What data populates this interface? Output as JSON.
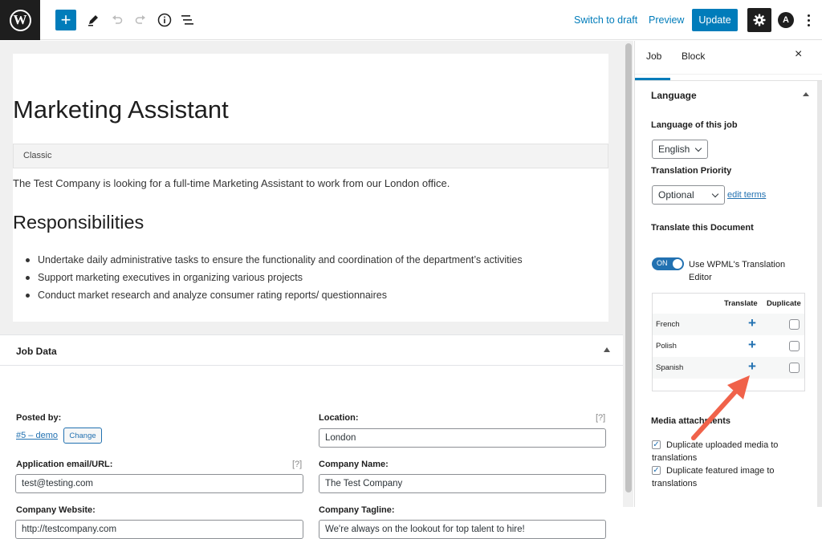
{
  "colors": {
    "accent": "#007cba",
    "dark": "#1e1e1e",
    "annotation_arrow": "#f0624a"
  },
  "toolbar": {
    "switch_to_draft": "Switch to draft",
    "preview": "Preview",
    "update": "Update",
    "astra_letter": "A"
  },
  "editor": {
    "title": "Marketing Assistant",
    "classic_label": "Classic",
    "intro": "The Test Company is looking for a full-time Marketing Assistant to work from our London office.",
    "responsibilities_heading": "Responsibilities",
    "responsibilities": [
      "Undertake daily administrative tasks to ensure the functionality and coordination of the department’s activities",
      "Support marketing executives in organizing various projects",
      "Conduct market research and analyze consumer rating reports/ questionnaires"
    ]
  },
  "job_data": {
    "title": "Job Data",
    "posted_by_label": "Posted by:",
    "posted_by_value": "#5 – demo",
    "change_button": "Change",
    "location_label": "Location:",
    "location_help": "[?]",
    "location_value": "London",
    "application_label": "Application email/URL:",
    "application_help": "[?]",
    "application_value": "test@testing.com",
    "company_name_label": "Company Name:",
    "company_name_value": "The Test Company",
    "company_website_label": "Company Website:",
    "company_website_value": "http://testcompany.com",
    "company_tagline_label": "Company Tagline:",
    "company_tagline_value": "We're always on the lookout for top talent to hire!"
  },
  "sidebar": {
    "tab_job": "Job",
    "tab_block": "Block",
    "close": "×",
    "language_heading": "Language",
    "language_of_job_label": "Language of this job",
    "language_selected": "English",
    "translation_priority_label": "Translation Priority",
    "priority_selected": "Optional",
    "edit_terms": "edit terms",
    "translate_doc_label": "Translate this Document",
    "toggle_state": "ON",
    "toggle_label": "Use WPML's Translation Editor",
    "table_headers": {
      "translate": "Translate",
      "duplicate": "Duplicate"
    },
    "languages": [
      {
        "name": "French",
        "action": "+"
      },
      {
        "name": "Polish",
        "action": "+"
      },
      {
        "name": "Spanish",
        "action": "+"
      }
    ],
    "media_label": "Media attachments",
    "media_options": [
      {
        "label": "Duplicate uploaded media to translations",
        "checked": true
      },
      {
        "label": "Duplicate featured image to translations",
        "checked": true
      }
    ],
    "check_mark": "✓"
  }
}
